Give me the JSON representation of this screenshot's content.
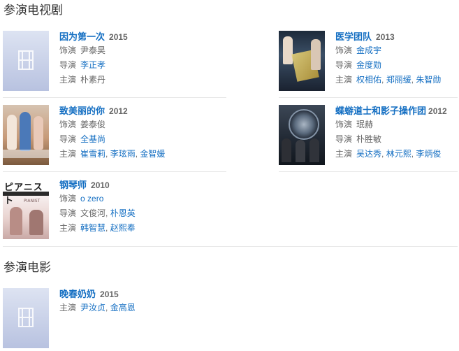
{
  "sections": {
    "tv_title": "参演电视剧",
    "movie_title": "参演电影"
  },
  "labels": {
    "role": "饰演",
    "director": "导演",
    "stars": "主演"
  },
  "tv": [
    {
      "title": "因为第一次",
      "year": "2015",
      "role": "尹泰昊",
      "directors": [
        "李正孝"
      ],
      "stars": [
        "朴素丹"
      ]
    },
    {
      "title": "医学团队",
      "year": "2013",
      "role": "金成宇",
      "directors": [
        "金度勋"
      ],
      "stars": [
        "权相佑",
        "郑丽缓",
        "朱智勋"
      ]
    },
    {
      "title": "致美丽的你",
      "year": "2012",
      "role": "姜泰俊",
      "directors": [
        "全基尚"
      ],
      "stars": [
        "崔雪莉",
        "李玹雨",
        "金智媛"
      ]
    },
    {
      "title": "蝶蝣道士和影子操作团",
      "year": "2012",
      "role": "珉赫",
      "directors": [
        "朴胜敏"
      ],
      "stars": [
        "吴达秀",
        "林元熙",
        "李炳俊"
      ]
    },
    {
      "title": "钢琴师",
      "year": "2010",
      "role": "o zero",
      "directors": [
        "文俊河",
        "朴恩英"
      ],
      "stars": [
        "韩智慧",
        "赵熙奉"
      ]
    }
  ],
  "movies": [
    {
      "title": "晚春奶奶",
      "year": "2015",
      "stars": [
        "尹汝贞",
        "金高恩"
      ]
    }
  ],
  "poster_art": {
    "gangqin_text": "ピアニスト",
    "gangqin_sub": "PIANIST"
  }
}
